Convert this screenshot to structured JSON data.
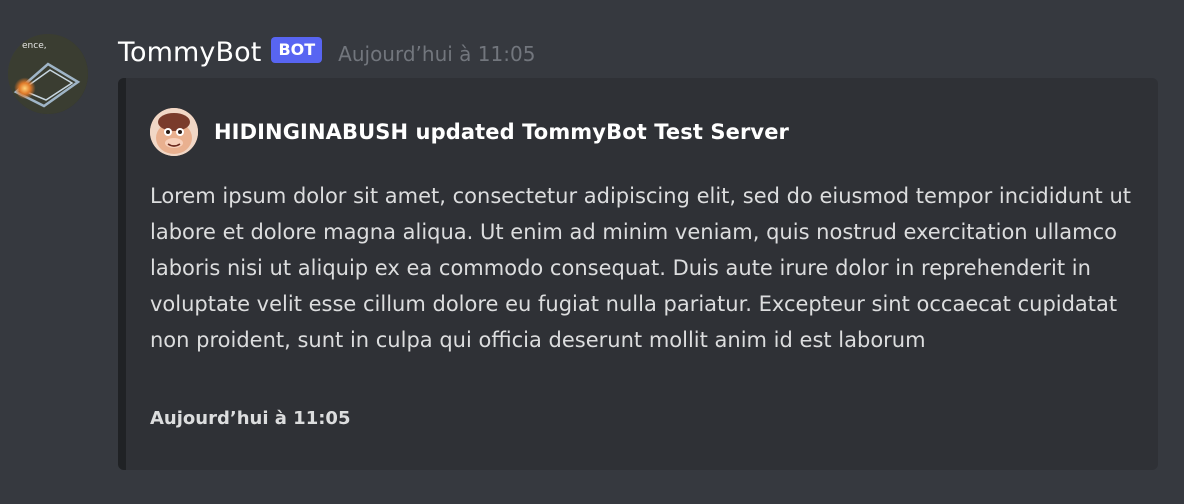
{
  "message": {
    "username": "TommyBot",
    "bot_tag": "BOT",
    "timestamp": "Aujourd’hui à 11:05",
    "avatar_text": "ence,"
  },
  "embed": {
    "author": "HIDINGINABUSH updated TommyBot Test Server",
    "description": "Lorem ipsum dolor sit amet, consectetur adipiscing elit, sed do eiusmod tempor incididunt ut labore et dolore magna aliqua. Ut enim ad minim veniam, quis nostrud exercitation ullamco laboris nisi ut aliquip ex ea commodo consequat. Duis aute irure dolor in reprehenderit in voluptate velit esse cillum dolore eu fugiat nulla pariatur. Excepteur sint occaecat cupidatat non proident, sunt in culpa qui officia deserunt mollit anim id est laborum",
    "footer": "Aujourd’hui à 11:05"
  },
  "colors": {
    "background": "#36393f",
    "embed_background": "#2f3136",
    "bot_tag": "#5865f2",
    "timestamp": "#72767d"
  }
}
